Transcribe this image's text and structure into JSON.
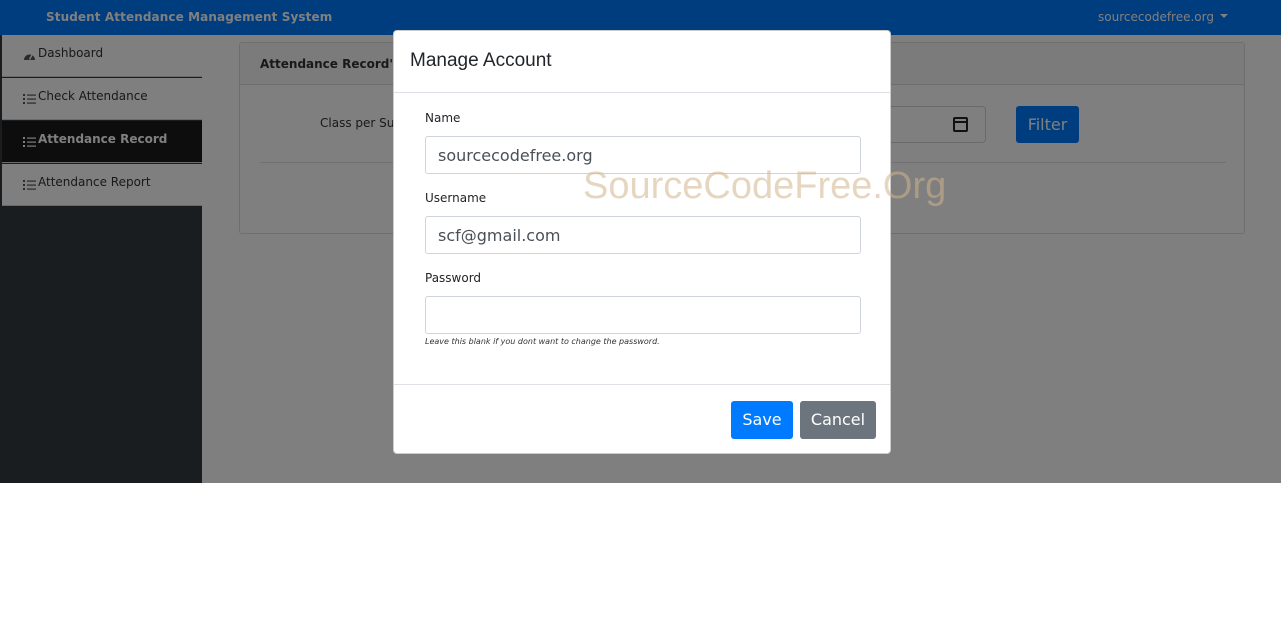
{
  "navbar": {
    "brand": "Student Attendance Management System",
    "user": "sourcecodefree.org"
  },
  "sidebar": {
    "items": [
      {
        "label": "Dashboard",
        "icon": "tachometer-icon",
        "active": false
      },
      {
        "label": "Check Attendance",
        "icon": "list-check-icon",
        "active": false
      },
      {
        "label": "Attendance Record",
        "icon": "list-check-icon",
        "active": true
      },
      {
        "label": "Attendance Report",
        "icon": "list-check-icon",
        "active": false
      }
    ]
  },
  "main": {
    "card_title": "Attendance Record's",
    "filter_label": "Class per Subject",
    "filter_button": "Filter"
  },
  "modal": {
    "title": "Manage Account",
    "name_label": "Name",
    "name_value": "sourcecodefree.org",
    "username_label": "Username",
    "username_value": "scf@gmail.com",
    "password_label": "Password",
    "password_value": "",
    "password_help": "Leave this blank if you dont want to change the password.",
    "save_label": "Save",
    "cancel_label": "Cancel"
  },
  "watermark": "SourceCodeFree.Org",
  "colors": {
    "primary": "#007bff",
    "secondary": "#6c757d",
    "sidebar_bg": "#343a40",
    "active_item": "#1a1a1a"
  }
}
